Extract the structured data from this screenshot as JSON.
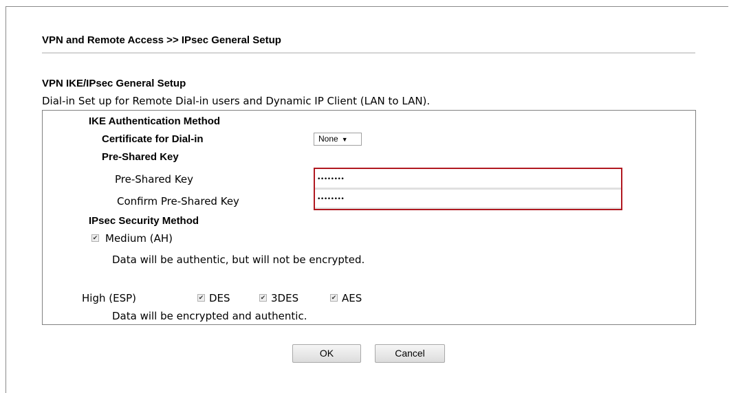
{
  "breadcrumb": "VPN and Remote Access >> IPsec General Setup",
  "section": {
    "title": "VPN IKE/IPsec General Setup",
    "description": "Dial-in Set up for Remote Dial-in users and Dynamic IP Client (LAN to LAN)."
  },
  "ike": {
    "heading": "IKE Authentication Method",
    "certificate_label": "Certificate for Dial-in",
    "certificate_value": "None",
    "psk_heading": "Pre-Shared Key",
    "psk_label": "Pre-Shared Key",
    "psk_value": "••••••••",
    "confirm_label": "Confirm Pre-Shared Key",
    "confirm_value": "••••••••"
  },
  "ipsec": {
    "heading": "IPsec Security Method",
    "medium_label": "Medium (AH)",
    "medium_checked": true,
    "medium_desc": "Data will be authentic, but will not be encrypted.",
    "high_label": "High (ESP)",
    "des_label": "DES",
    "des_checked": true,
    "tdes_label": "3DES",
    "tdes_checked": true,
    "aes_label": "AES",
    "aes_checked": true,
    "high_desc": "Data will be encrypted and authentic."
  },
  "buttons": {
    "ok": "OK",
    "cancel": "Cancel"
  },
  "colors": {
    "highlight_border": "#b0171f"
  }
}
